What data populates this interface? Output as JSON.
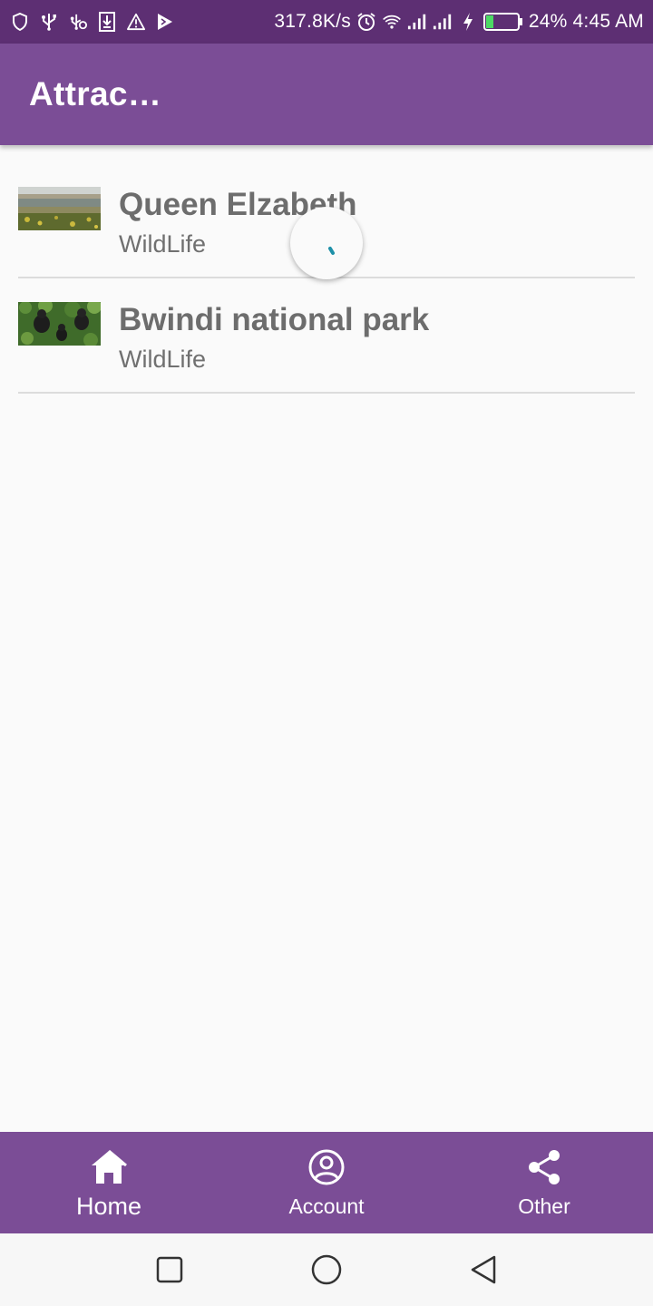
{
  "status_bar": {
    "network_speed": "317.8K/s",
    "battery_percent": "24%",
    "battery_level": 0.24,
    "time": "4:45 AM",
    "left_icons": [
      "shield-icon",
      "usb-icon",
      "usb-debug-icon",
      "download-icon",
      "warning-icon",
      "play-store-icon"
    ],
    "right_icons": [
      "alarm-icon",
      "wifi-icon",
      "signal-icon",
      "signal-icon",
      "charging-icon",
      "battery-icon"
    ]
  },
  "app_bar": {
    "title": "Attrac…"
  },
  "attractions": [
    {
      "title": "Queen Elzabeth",
      "subtitle": "WildLife",
      "thumbnail": "savanna-lake-landscape"
    },
    {
      "title": "Bwindi national park",
      "subtitle": "WildLife",
      "thumbnail": "gorillas-in-forest"
    }
  ],
  "loading": {
    "icon": "loading-spinner-icon"
  },
  "bottom_nav": {
    "items": [
      {
        "label": "Home",
        "icon": "home-icon",
        "active": true
      },
      {
        "label": "Account",
        "icon": "account-circle-icon",
        "active": false
      },
      {
        "label": "Other",
        "icon": "share-icon",
        "active": false
      }
    ]
  },
  "system_nav": {
    "buttons": [
      "recents-square-icon",
      "home-circle-icon",
      "back-triangle-icon"
    ]
  },
  "colors": {
    "status_bar": "#5d2f73",
    "primary": "#7b4d96",
    "background": "#fafafa",
    "spinner_accent": "#1e90a8"
  }
}
